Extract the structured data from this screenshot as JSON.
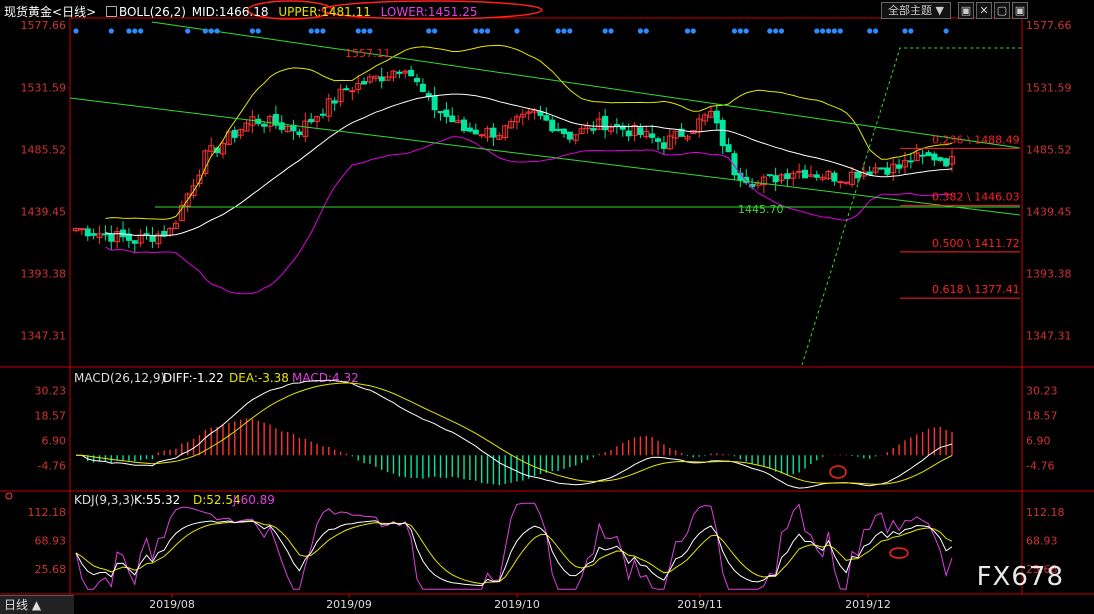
{
  "header": {
    "instrument": "现货黄金",
    "period": "<日线>",
    "boll_label": "BOLL(26,2)",
    "mid": "MID:1466.18",
    "upper": "UPPER:1481.11",
    "lower": "LOWER:1451.25",
    "theme_button": "全部主题",
    "win_buttons": [
      "▣",
      "✕",
      "▢",
      "▣",
      "✕"
    ]
  },
  "colors": {
    "up": "#ff3232",
    "down": "#00e6a0",
    "mid": "#ffffff",
    "upper": "#e6e600",
    "lower": "#e000e0",
    "channel": "#33dd33",
    "fib": "#ff2020",
    "axis": "#cc0000"
  },
  "chart_data": [
    {
      "type": "candlestick",
      "title": "现货黄金<日线>",
      "y_ticks": [
        "1577.66",
        "1531.59",
        "1485.52",
        "1439.45",
        "1393.38",
        "1347.31"
      ],
      "ylim": [
        1330,
        1580
      ],
      "x_ticks": [
        "2019/08",
        "2019/09",
        "2019/10",
        "2019/11",
        "2019/12"
      ],
      "annotations": [
        {
          "text": "1557.11",
          "value": 1557.11
        },
        {
          "text": "1445.70",
          "value": 1445.7
        }
      ],
      "fibonacci": [
        {
          "label": "0.236 \\ 1488.49",
          "value": 1488.49
        },
        {
          "label": "0.382 \\ 1446.03",
          "value": 1446.03
        },
        {
          "label": "0.500 \\ 1411.72",
          "value": 1411.72
        },
        {
          "label": "0.618 \\ 1377.41",
          "value": 1377.41
        }
      ],
      "series": [
        {
          "name": "BOLL(26,2)",
          "indicator": "BOLL"
        },
        {
          "name": "MID",
          "value": 1466.18
        },
        {
          "name": "UPPER",
          "value": 1481.11
        },
        {
          "name": "LOWER",
          "value": 1451.25
        }
      ]
    },
    {
      "type": "macd",
      "title": "MACD(26,12,9)",
      "labels": {
        "diff": "DIFF:-1.22",
        "dea": "DEA:-3.38",
        "macd": "MACD:4.32"
      },
      "y_ticks": [
        "30.23",
        "18.57",
        "6.90",
        "-4.76"
      ],
      "ylim": [
        -12,
        36
      ]
    },
    {
      "type": "kdj",
      "title": "KDJ(9,3,3)",
      "labels": {
        "k": "K:55.32",
        "d": "D:52.54",
        "j": "J:60.89"
      },
      "y_ticks": [
        "112.18",
        "68.93",
        "25.68"
      ],
      "ylim": [
        0,
        130
      ]
    }
  ],
  "footer": {
    "period_button": "日线 ▲"
  },
  "watermark": "FX678"
}
